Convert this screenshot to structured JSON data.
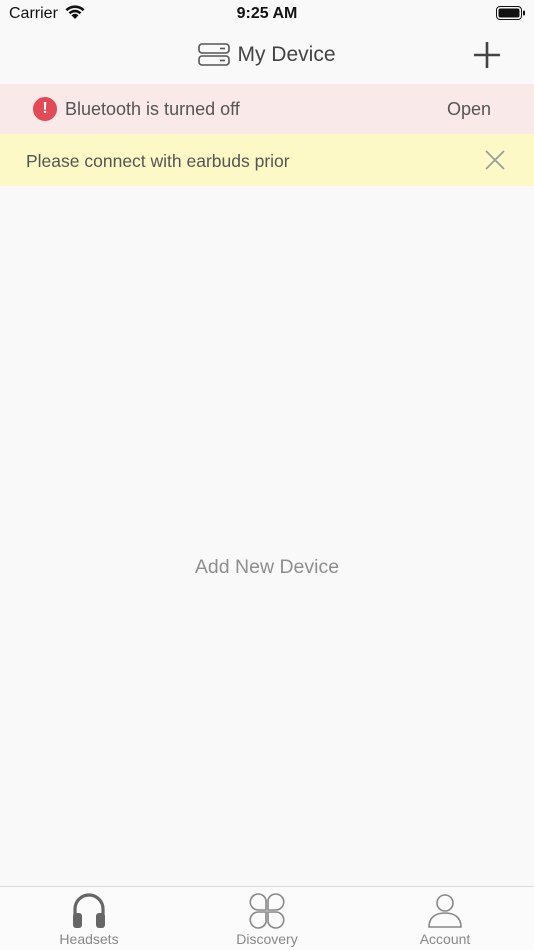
{
  "status_bar": {
    "carrier": "Carrier",
    "time": "9:25 AM"
  },
  "nav": {
    "title": "My Device",
    "device_icon": "device-list-icon",
    "add_icon": "plus-icon"
  },
  "bluetooth_banner": {
    "icon": "alert-icon",
    "message": "Bluetooth is turned off",
    "action_label": "Open",
    "background": "#f9e9e9",
    "alert_color": "#e24b55"
  },
  "connect_banner": {
    "message": "Please connect with earbuds prior",
    "close_icon": "close-icon",
    "background": "#fcf9c6"
  },
  "main": {
    "empty_label": "Add New Device"
  },
  "tab_bar": {
    "tabs": [
      {
        "label": "Headsets",
        "icon": "headphones-icon",
        "active": true
      },
      {
        "label": "Discovery",
        "icon": "discovery-icon",
        "active": false
      },
      {
        "label": "Account",
        "icon": "person-icon",
        "active": false
      }
    ]
  }
}
